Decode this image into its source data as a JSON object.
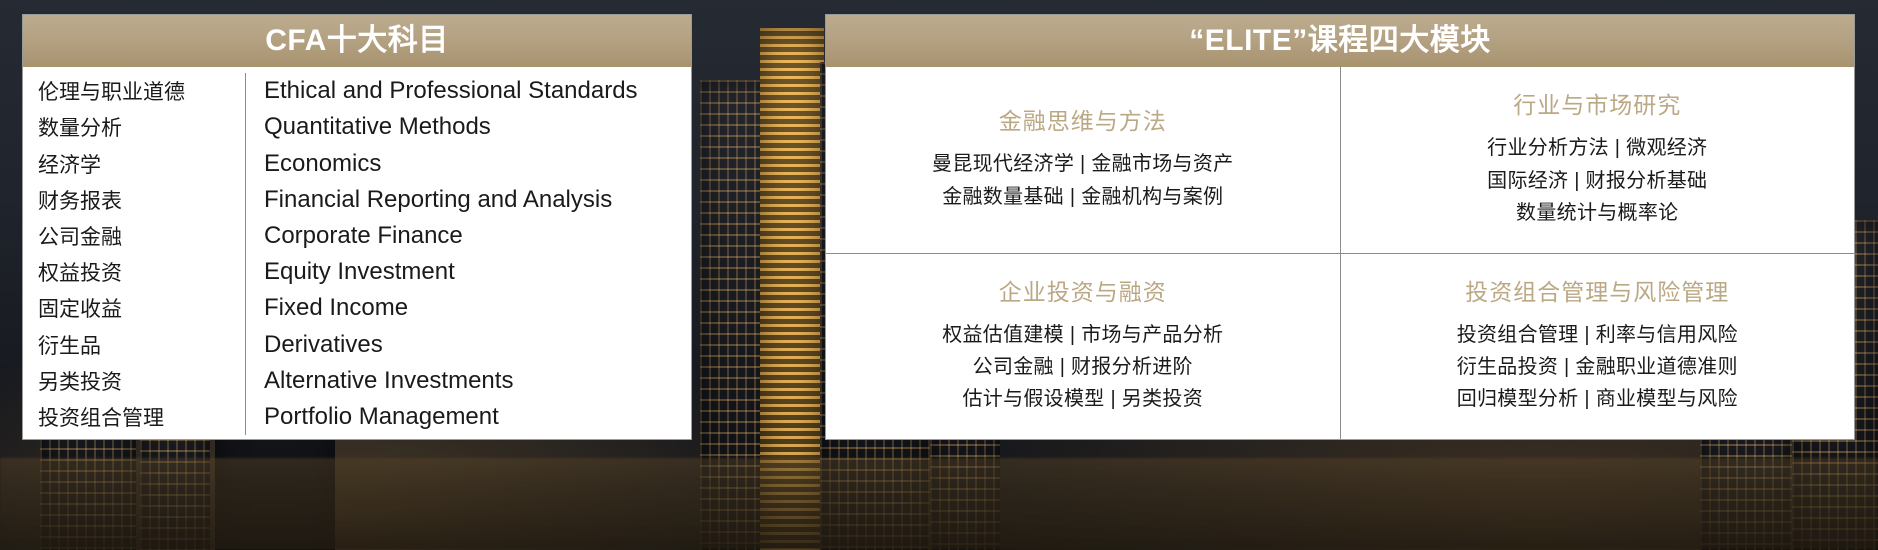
{
  "left_panel": {
    "header_title": "CFA十大科目",
    "rows": [
      {
        "cn": "伦理与职业道德",
        "en": "Ethical and Professional Standards"
      },
      {
        "cn": "数量分析",
        "en": "Quantitative Methods"
      },
      {
        "cn": "经济学",
        "en": "Economics"
      },
      {
        "cn": "财务报表",
        "en": "Financial Reporting and Analysis"
      },
      {
        "cn": "公司金融",
        "en": "Corporate Finance"
      },
      {
        "cn": "权益投资",
        "en": "Equity Investment"
      },
      {
        "cn": "固定收益",
        "en": "Fixed Income"
      },
      {
        "cn": "衍生品",
        "en": "Derivatives"
      },
      {
        "cn": "另类投资",
        "en": "Alternative Investments"
      },
      {
        "cn": "投资组合管理",
        "en": "Portfolio Management"
      }
    ]
  },
  "right_panel": {
    "header_title": "“ELITE”课程四大模块",
    "modules": [
      {
        "title": "金融思维与方法",
        "lines": [
          "曼昆现代经济学 | 金融市场与资产",
          "金融数量基础 | 金融机构与案例"
        ]
      },
      {
        "title": "行业与市场研究",
        "lines": [
          "行业分析方法 | 微观经济",
          "国际经济 | 财报分析基础",
          "数量统计与概率论"
        ]
      },
      {
        "title": "企业投资与融资",
        "lines": [
          "权益估值建模 | 市场与产品分析",
          "公司金融 | 财报分析进阶",
          "估计与假设模型 | 另类投资"
        ]
      },
      {
        "title": "投资组合管理与风险管理",
        "lines": [
          "投资组合管理 | 利率与信用风险",
          "衍生品投资 | 金融职业道德准则",
          "回归模型分析 | 商业模型与风险"
        ]
      }
    ]
  },
  "center": {
    "arrow_direction": "right"
  },
  "colors": {
    "header_gold": "#b4a283",
    "module_title_gold": "#bba884",
    "divider_gray": "#8c8c8c",
    "panel_white": "#ffffff",
    "arrow_gold": "#b3a183"
  }
}
